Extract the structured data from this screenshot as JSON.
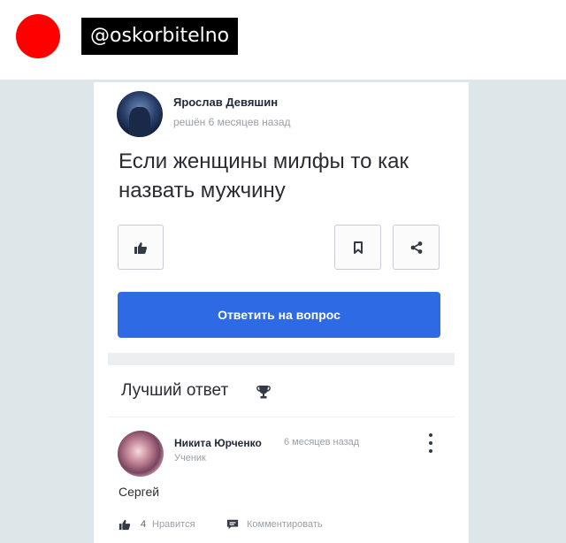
{
  "header": {
    "handle": "@oskorbitelno"
  },
  "question": {
    "author": "Ярослав Девяшин",
    "time": "решён 6 месяцев назад",
    "text": "Если женщины милфы то как назвать мужчину",
    "answer_button": "Ответить на вопрос"
  },
  "best_answer": {
    "title": "Лучший ответ",
    "author": "Никита Юрченко",
    "time": "6 месяцев назад",
    "rank": "Ученик",
    "text": "Сергей",
    "likes": "4",
    "like_label": "Нравится",
    "comment_label": "Комментировать"
  },
  "icons": {
    "like": "thumbs-up-icon",
    "bookmark": "bookmark-icon",
    "share": "share-icon",
    "trophy": "trophy-icon",
    "more": "more-vertical-icon",
    "comment": "comment-icon"
  },
  "colors": {
    "red_dot": "#ff0000",
    "primary_button": "#2d6ae3",
    "background": "#dde6e9"
  }
}
